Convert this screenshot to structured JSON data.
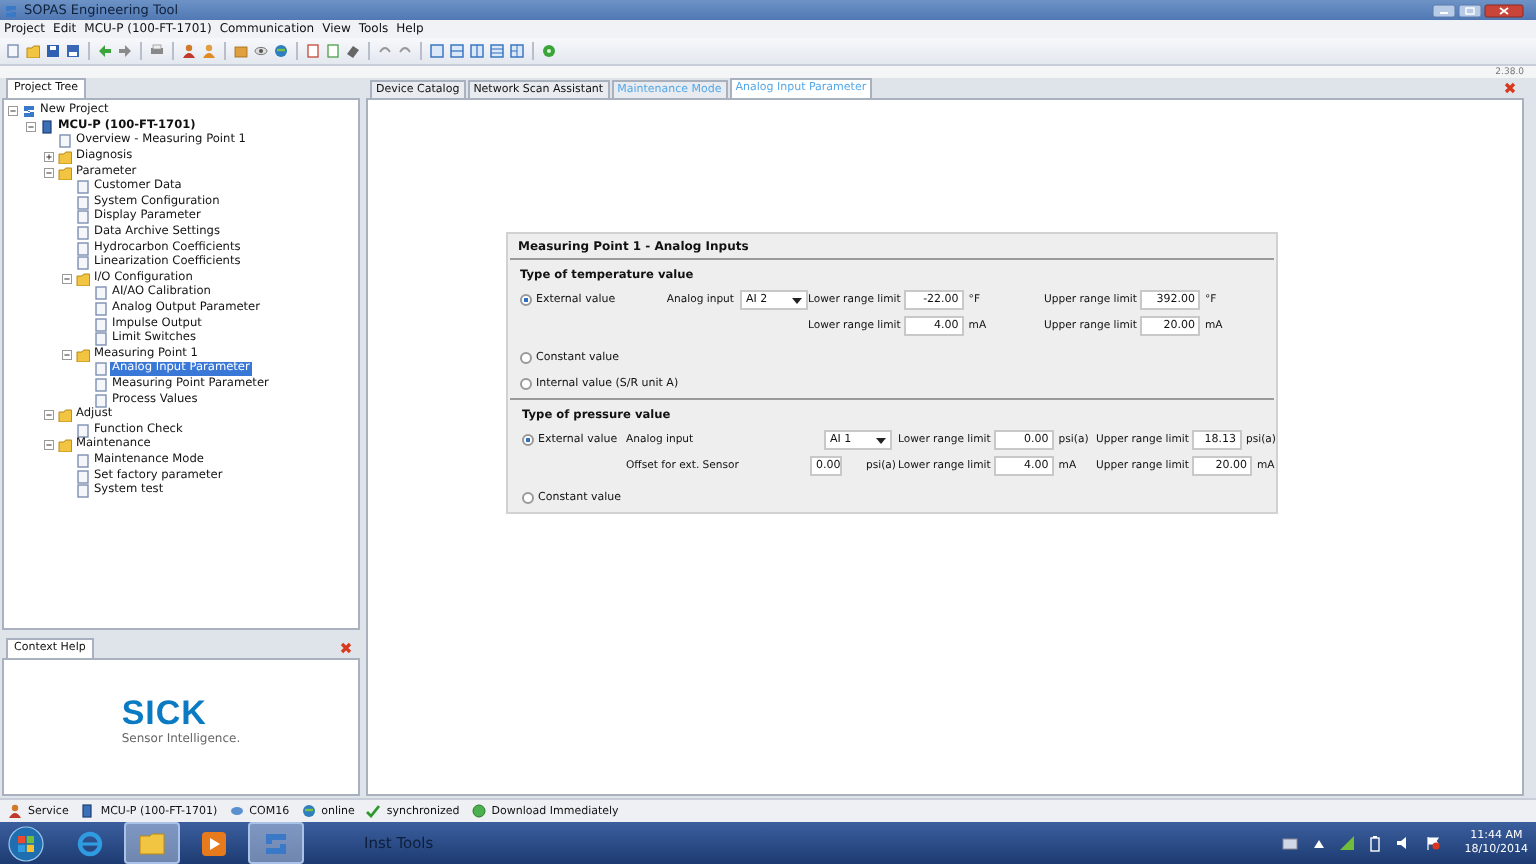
{
  "window": {
    "title": "SOPAS Engineering Tool",
    "version": "2.38.0"
  },
  "menu": [
    "Project",
    "Edit",
    "MCU-P (100-FT-1701)",
    "Communication",
    "View",
    "Tools",
    "Help"
  ],
  "project_tree": {
    "tab": "Project Tree",
    "items": [
      {
        "label": "New Project",
        "kind": "project",
        "expanded": true,
        "selected": false,
        "children": [
          {
            "label": "MCU-P (100-FT-1701)",
            "kind": "device",
            "expanded": true,
            "selected": false,
            "children": [
              {
                "label": "Overview - Measuring Point 1",
                "kind": "page",
                "selected": false
              },
              {
                "label": "Diagnosis",
                "kind": "folder",
                "expanded": false,
                "selected": false
              },
              {
                "label": "Parameter",
                "kind": "folder",
                "expanded": true,
                "selected": false,
                "children": [
                  {
                    "label": "Customer Data",
                    "kind": "page",
                    "selected": false
                  },
                  {
                    "label": "System Configuration",
                    "kind": "page",
                    "selected": false
                  },
                  {
                    "label": "Display Parameter",
                    "kind": "page",
                    "selected": false
                  },
                  {
                    "label": "Data Archive Settings",
                    "kind": "page",
                    "selected": false
                  },
                  {
                    "label": "Hydrocarbon Coefficients",
                    "kind": "page",
                    "selected": false
                  },
                  {
                    "label": "Linearization Coefficients",
                    "kind": "page",
                    "selected": false
                  },
                  {
                    "label": "I/O Configuration",
                    "kind": "folder",
                    "expanded": true,
                    "selected": false,
                    "children": [
                      {
                        "label": "AI/AO Calibration",
                        "kind": "page",
                        "selected": false
                      },
                      {
                        "label": "Analog Output Parameter",
                        "kind": "page",
                        "selected": false
                      },
                      {
                        "label": "Impulse Output",
                        "kind": "page",
                        "selected": false
                      },
                      {
                        "label": "Limit Switches",
                        "kind": "page",
                        "selected": false
                      }
                    ]
                  },
                  {
                    "label": "Measuring Point 1",
                    "kind": "folder",
                    "expanded": true,
                    "selected": false,
                    "children": [
                      {
                        "label": "Analog Input Parameter",
                        "kind": "page",
                        "selected": true
                      },
                      {
                        "label": "Measuring Point Parameter",
                        "kind": "page",
                        "selected": false
                      },
                      {
                        "label": "Process Values",
                        "kind": "page",
                        "selected": false
                      }
                    ]
                  }
                ]
              },
              {
                "label": "Adjust",
                "kind": "folder",
                "expanded": true,
                "selected": false,
                "children": [
                  {
                    "label": "Function Check",
                    "kind": "page",
                    "selected": false
                  }
                ]
              },
              {
                "label": "Maintenance",
                "kind": "folder",
                "expanded": true,
                "selected": false,
                "children": [
                  {
                    "label": "Maintenance Mode",
                    "kind": "page",
                    "selected": false
                  },
                  {
                    "label": "Set factory parameter",
                    "kind": "page",
                    "selected": false
                  },
                  {
                    "label": "System test",
                    "kind": "page",
                    "selected": false
                  }
                ]
              }
            ]
          }
        ]
      }
    ]
  },
  "context_help": {
    "tab": "Context Help",
    "brand": "SICK",
    "tagline": "Sensor Intelligence."
  },
  "tabs": [
    {
      "label": "Device Catalog",
      "selected": false,
      "highlighted": false
    },
    {
      "label": "Network Scan Assistant",
      "selected": false,
      "highlighted": false
    },
    {
      "label": "Maintenance Mode",
      "selected": false,
      "highlighted": true
    },
    {
      "label": "Analog Input Parameter",
      "selected": true,
      "highlighted": true
    }
  ],
  "panel": {
    "title": "Measuring Point 1 - Analog Inputs",
    "sections": [
      {
        "title": "Type of temperature value",
        "options": [
          {
            "label": "External value",
            "selected": true
          },
          {
            "label": "Constant value",
            "selected": false
          },
          {
            "label": "Internal value (S/R unit A)",
            "selected": false
          }
        ],
        "analog_input": {
          "label": "Analog input",
          "value": "AI 2"
        },
        "ranges": [
          {
            "label": "Lower range limit",
            "value": "-22.00",
            "unit": "°F"
          },
          {
            "label": "Upper range limit",
            "value": "392.00",
            "unit": "°F"
          },
          {
            "label": "Lower range limit",
            "value": "4.00",
            "unit": "mA"
          },
          {
            "label": "Upper range limit",
            "value": "20.00",
            "unit": "mA"
          }
        ]
      },
      {
        "title": "Type of pressure value",
        "options": [
          {
            "label": "External value",
            "selected": true
          },
          {
            "label": "Constant value",
            "selected": false
          }
        ],
        "analog_input": {
          "label": "Analog input",
          "value": "AI 1"
        },
        "offset": {
          "label": "Offset for ext. Sensor",
          "value": "0.00",
          "unit": "psi(a)"
        },
        "ranges": [
          {
            "label": "Lower range limit",
            "value": "0.00",
            "unit": "psi(a)"
          },
          {
            "label": "Upper range limit",
            "value": "18.13",
            "unit": "psi(a)"
          },
          {
            "label": "Lower range limit",
            "value": "4.00",
            "unit": "mA"
          },
          {
            "label": "Upper range limit",
            "value": "20.00",
            "unit": "mA"
          }
        ]
      }
    ]
  },
  "status_bar": [
    {
      "label": "Service",
      "kind": "user"
    },
    {
      "label": "MCU-P (100-FT-1701)",
      "kind": "device"
    },
    {
      "label": "COM16",
      "kind": "port"
    },
    {
      "label": "online",
      "kind": "globe"
    },
    {
      "label": "synchronized",
      "kind": "check"
    },
    {
      "label": "Download Immediately",
      "kind": "download"
    }
  ],
  "taskbar": {
    "active_label": "Inst Tools",
    "time": "11:44 AM",
    "date": "18/10/2014"
  }
}
